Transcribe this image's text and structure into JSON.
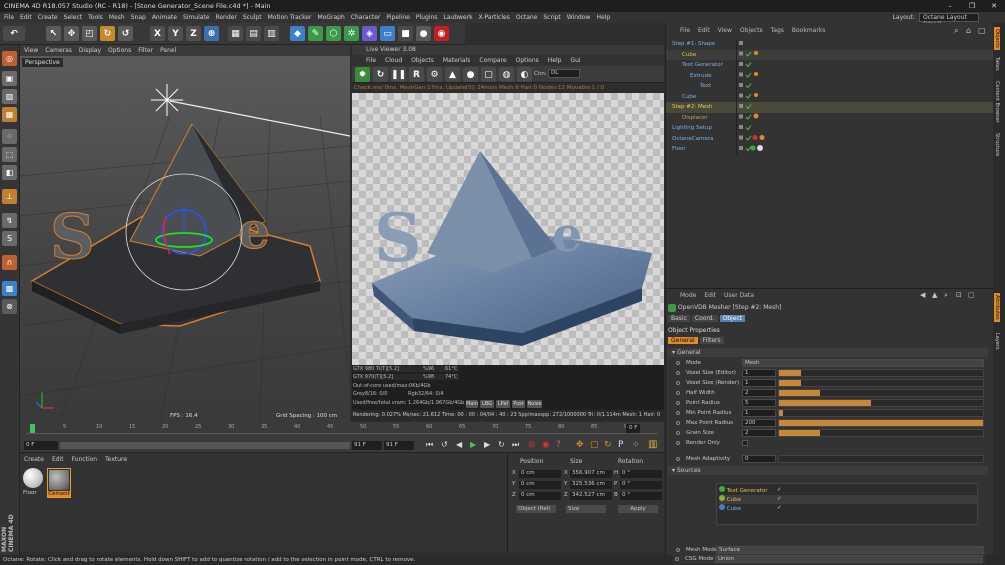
{
  "window": {
    "title": "CINEMA 4D R18.057 Studio (RC - R18) - [Stone Generator_Scene File.c4d *] - Main",
    "controls": [
      "–",
      "❐",
      "✕"
    ]
  },
  "menubar": [
    "File",
    "Edit",
    "Create",
    "Select",
    "Tools",
    "Mesh",
    "Snap",
    "Animate",
    "Simulate",
    "Render",
    "Sculpt",
    "Motion Tracker",
    "MoGraph",
    "Character",
    "Pipeline",
    "Plugins",
    "Laubwerk",
    "X-Particles",
    "Octane",
    "Script",
    "Window",
    "Help"
  ],
  "layout": {
    "label": "Layout:",
    "value": "Octane Layout (User)"
  },
  "viewport": {
    "menu": [
      "View",
      "Cameras",
      "Display",
      "Options",
      "Filter",
      "Panel"
    ],
    "label": "Perspective",
    "fps": "FPS : 16.4",
    "grid_spacing": "Grid Spacing : 100 cm"
  },
  "live_viewer": {
    "header": "Live Viewer 3.08",
    "menu": [
      "File",
      "Cloud",
      "Objects",
      "Materials",
      "Compare",
      "Options",
      "Help",
      "Gui"
    ],
    "chn_label": "Chn:",
    "chn_value": "DL",
    "status_line": "Check:ms/ 0ms. MeshGen:17ms. Update[0]: 24ms/s Mesh:6 Hair:0 Nodes:12 Movable:1 / 0",
    "gpu_rows": [
      {
        "name": "GTX 980 Ti(T)[5.2]",
        "pct": "%96",
        "temp": "61°C"
      },
      {
        "name": "GTX 970(T)[5.2]",
        "pct": "%98",
        "temp": "74°C"
      }
    ],
    "outofcore": "Out-of-core used/max:0Kb/4Gb",
    "grey": "Grey8/16: 0/0",
    "rgb": "Rgb32/64: 0/4",
    "vram": "Used/free/total vram: 1.264Gb/1.967Gb/4Gb",
    "buttons": [
      "Main",
      "LBG",
      "LPaf",
      "Post",
      "Noise"
    ],
    "render_stats": "Rendering: 0.027%   Ms/sec: 21.612   Time: 00 : 00 : 04/04 : 40 : 23   Spp/maxspp: 272/1000000   Tri: 0/1.114m   Mesh: 1   Hair: 0"
  },
  "timeline": {
    "ticks": [
      "0",
      "5",
      "10",
      "15",
      "20",
      "25",
      "30",
      "35",
      "40",
      "45",
      "50",
      "55",
      "60",
      "65",
      "70",
      "75",
      "80",
      "85",
      "90"
    ],
    "current_frame": "0 F",
    "start": "0 F",
    "end_field": "91 F",
    "end_field2": "91 F",
    "frame_right": "0 F"
  },
  "materials": {
    "menu": [
      "Create",
      "Edit",
      "Function",
      "Texture"
    ],
    "items": [
      {
        "name": "Floor",
        "color": "#e8e8e8",
        "selected": false
      },
      {
        "name": "Cement",
        "color": "#9a9a9a",
        "selected": true
      }
    ]
  },
  "coords": {
    "headers": [
      "Position",
      "Size",
      "Rotation"
    ],
    "rows": [
      {
        "axis": "X",
        "pos": "0 cm",
        "size_axis": "X",
        "size": "356.907 cm",
        "rot_axis": "H",
        "rot": "0 °"
      },
      {
        "axis": "Y",
        "pos": "0 cm",
        "size_axis": "Y",
        "size": "325.536 cm",
        "rot_axis": "P",
        "rot": "0 °"
      },
      {
        "axis": "Z",
        "pos": "0 cm",
        "size_axis": "Z",
        "size": "342.527 cm",
        "rot_axis": "B",
        "rot": "0 °"
      }
    ],
    "mode1": "Object (Rel)",
    "mode2": "Size",
    "apply": "Apply"
  },
  "object_manager": {
    "menu": [
      "File",
      "Edit",
      "View",
      "Objects",
      "Tags",
      "Bookmarks"
    ],
    "rows": [
      {
        "name": "Step #1: Shape",
        "color": "#7fb0e0",
        "indent": 0
      },
      {
        "name": "Cube",
        "color": "#e0c040",
        "indent": 1
      },
      {
        "name": "Text Generator",
        "color": "#7fb0e0",
        "indent": 1
      },
      {
        "name": "Extrude",
        "color": "#7fb0e0",
        "indent": 2
      },
      {
        "name": "Text",
        "color": "#7fb0e0",
        "indent": 3
      },
      {
        "name": "Cube",
        "color": "#7fb0e0",
        "indent": 1
      },
      {
        "name": "Step #2: Mesh",
        "color": "#e0d060",
        "indent": 0
      },
      {
        "name": "Displacer",
        "color": "#c0a060",
        "indent": 1
      },
      {
        "name": "Lighting Setup",
        "color": "#7fb0e0",
        "indent": 0
      },
      {
        "name": "OctaneCamera",
        "color": "#7fb0e0",
        "indent": 0
      },
      {
        "name": "Floor",
        "color": "#7fb0e0",
        "indent": 0
      }
    ]
  },
  "attributes": {
    "menu": [
      "Mode",
      "Edit",
      "User Data"
    ],
    "object_title": "OpenVDB Mesher [Step #2: Mesh]",
    "tabs": [
      "Basic",
      "Coord.",
      "Object"
    ],
    "section": "Object Properties",
    "subtabs": [
      "General",
      "Filters"
    ],
    "group": "General",
    "props": [
      {
        "label": "Mode",
        "value": "Mesh",
        "fill": null
      },
      {
        "label": "Voxel Size (Editor)",
        "value": "1",
        "fill": 0.11
      },
      {
        "label": "Voxel Size (Render)",
        "value": "1",
        "fill": 0.11
      },
      {
        "label": "Half Width",
        "value": "2",
        "fill": 0.2
      },
      {
        "label": "Point Radius",
        "value": "5",
        "fill": 0.45
      },
      {
        "label": "Min Point Radius",
        "value": "1",
        "fill": 0.02
      },
      {
        "label": "Max Point Radius",
        "value": "200",
        "fill": 1.0
      },
      {
        "label": "Grain Size",
        "value": "2",
        "fill": 0.2
      },
      {
        "label": "Render Only",
        "value": "",
        "fill": null
      },
      {
        "label": "Mesh Adaptivity",
        "value": "0",
        "fill": 0.0
      }
    ],
    "sources_label": "Sources",
    "sources": [
      {
        "name": "Text Generator",
        "color": "#e0c040"
      },
      {
        "name": "Cube",
        "color": "#e0c040"
      },
      {
        "name": "Cube",
        "color": "#7fb0e0"
      }
    ],
    "mesh_mode_label": "Mesh Mode",
    "mesh_mode": "Surface",
    "csg_label": "CSG Mode",
    "csg": "Union"
  },
  "right_strip": [
    "Objects",
    "Takes",
    "Content Browser",
    "Structure",
    "Attributes",
    "Layers"
  ],
  "status": "Octane:   Rotate: Click and drag to rotate elements. Hold down SHIFT to add to quantize rotation / add to the selection in point mode, CTRL to remove."
}
